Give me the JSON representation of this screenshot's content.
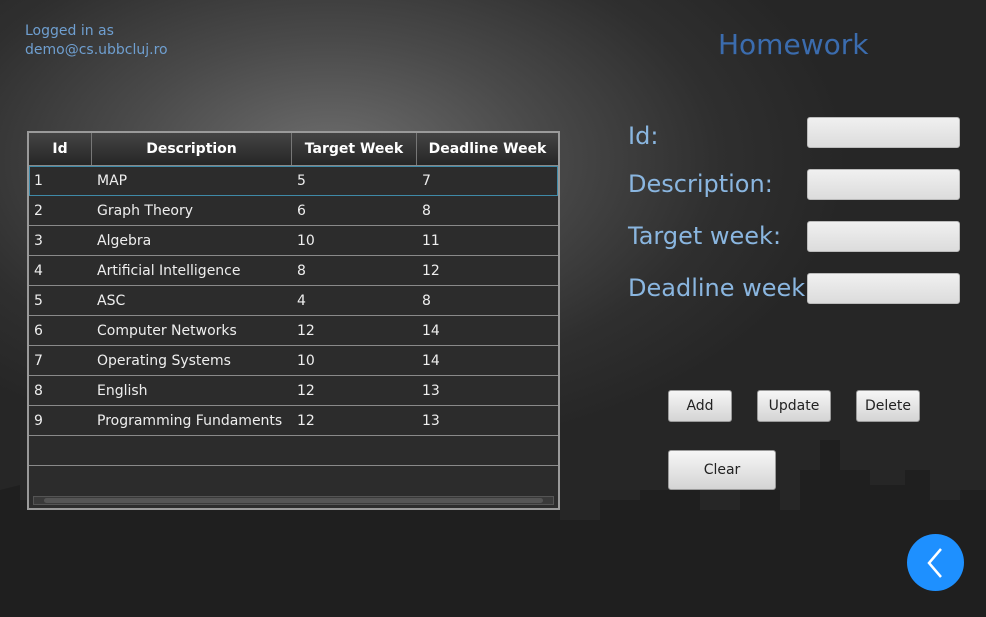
{
  "header": {
    "logged_in_label": "Logged in as",
    "user_email": "demo@cs.ubbcluj.ro",
    "title": "Homework"
  },
  "table": {
    "columns": [
      "Id",
      "Description",
      "Target Week",
      "Deadline Week"
    ],
    "rows": [
      [
        "1",
        "MAP",
        "5",
        "7"
      ],
      [
        "2",
        "Graph Theory",
        "6",
        "8"
      ],
      [
        "3",
        "Algebra",
        "10",
        "11"
      ],
      [
        "4",
        "Artificial Intelligence",
        "8",
        "12"
      ],
      [
        "5",
        "ASC",
        "4",
        "8"
      ],
      [
        "6",
        "Computer Networks",
        "12",
        "14"
      ],
      [
        "7",
        "Operating Systems",
        "10",
        "14"
      ],
      [
        "8",
        "English",
        "12",
        "13"
      ],
      [
        "9",
        "Programming Fundaments",
        "12",
        "13"
      ]
    ],
    "selected_row": 0
  },
  "form": {
    "id_label": "Id:",
    "description_label": "Description:",
    "target_week_label": "Target week:",
    "deadline_week_label": "Deadline week:",
    "id_value": "",
    "description_value": "",
    "target_week_value": "",
    "deadline_week_value": ""
  },
  "buttons": {
    "add": "Add",
    "update": "Update",
    "delete": "Delete",
    "clear": "Clear"
  },
  "back_button_icon": "chevron-left-icon",
  "colors": {
    "accent": "#1e90ff",
    "title": "#3b6cae",
    "label": "#8ab6e0"
  }
}
